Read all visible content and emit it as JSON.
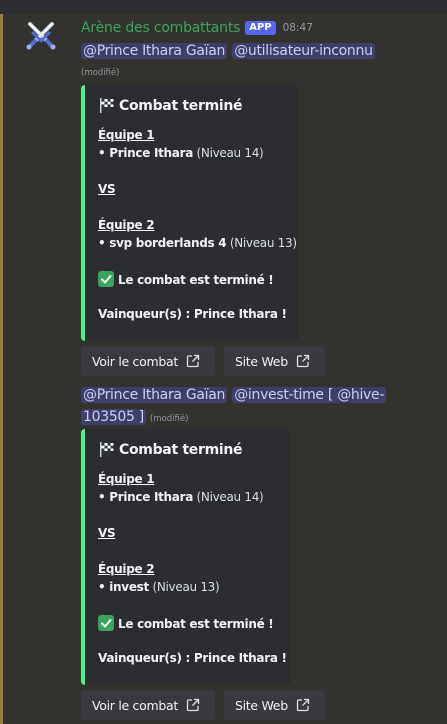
{
  "message": {
    "author": "Arène des combattants",
    "badge": "APP",
    "time": "08:47"
  },
  "block1": {
    "mentions": [
      "@Prince Ithara Gaïan",
      "@utilisateur-inconnu"
    ],
    "edited": "(modifié)",
    "embed": {
      "title": "Combat terminé",
      "team1_label": "Équipe 1",
      "team1_player": "• Prince Ithara",
      "team1_level": "(Niveau 14)",
      "vs": "VS",
      "team2_label": "Équipe 2",
      "team2_player": "• svp borderlands 4",
      "team2_level": "(Niveau 13)",
      "status": "Le combat est terminé !",
      "winner": "Vainqueur(s) : Prince Ithara !"
    },
    "buttons": [
      "Voir le combat",
      "Site Web"
    ]
  },
  "block2": {
    "mentions_line1": [
      "@Prince Ithara Gaïan",
      "@invest-time [ @hive-"
    ],
    "mentions_line2": "103505 ]",
    "edited": "(modifié)",
    "embed": {
      "title": "Combat terminé",
      "team1_label": "Équipe 1",
      "team1_player": "• Prince Ithara",
      "team1_level": "(Niveau 14)",
      "vs": "VS",
      "team2_label": "Équipe 2",
      "team2_player": "• invest",
      "team2_level": "(Niveau 13)",
      "status": "Le combat est terminé !",
      "winner": "Vainqueur(s) : Prince Ithara !"
    },
    "buttons": [
      "Voir le combat",
      "Site Web"
    ]
  },
  "icons": {
    "avatar": "crossed-swords-icon",
    "embed_title": "chequered-flag-icon",
    "status": "check-mark-button-icon",
    "button": "external-link-icon"
  },
  "colors": {
    "embed_accent": "#57f287",
    "username": "#3ba55d",
    "badge": "#5865f2",
    "mention_bg": "#3c4270"
  }
}
